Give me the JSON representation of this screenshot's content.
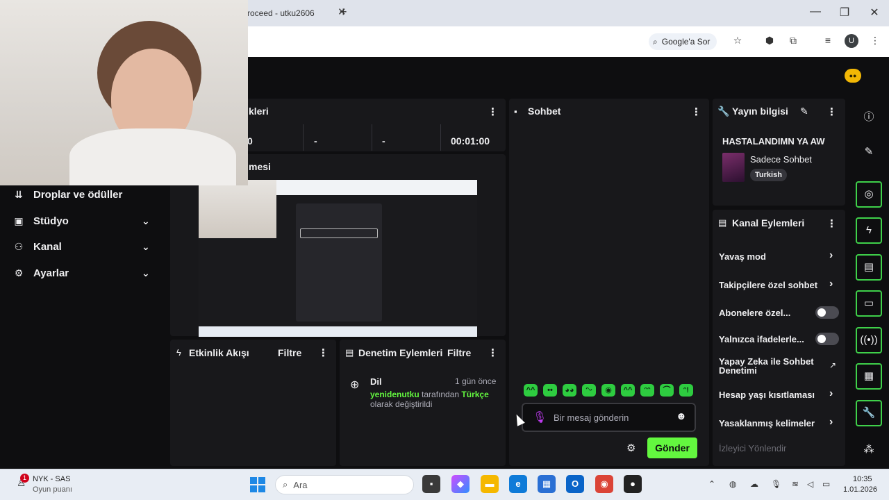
{
  "browser": {
    "tab_title": "roceed - utku2606",
    "tab_close": "✕",
    "new_tab": "+",
    "google_chip": "Google'a Sor",
    "profile_initial": "U"
  },
  "nav": {
    "items": [
      {
        "label": "Droplar ve ödüller",
        "icon": "drops-icon",
        "has_chevron": false
      },
      {
        "label": "Stüdyo",
        "icon": "studio-icon",
        "has_chevron": true
      },
      {
        "label": "Kanal",
        "icon": "channel-icon",
        "has_chevron": true
      },
      {
        "label": "Ayarlar",
        "icon": "settings-icon",
        "has_chevron": true
      }
    ]
  },
  "stats": {
    "title_fragment": "kleri",
    "values": [
      "0",
      "-",
      "-",
      "00:01:00"
    ]
  },
  "preview": {
    "title_fragment": "mesi"
  },
  "activity": {
    "title": "Etkinlik Akışı",
    "filter": "Filtre"
  },
  "moderation": {
    "title": "Denetim Eylemleri",
    "filter": "Filtre",
    "entry": {
      "type": "Dil",
      "time": "1 gün önce",
      "user": "yenidenutku",
      "mid": "tarafından",
      "value": "Türkçe",
      "tail": "olarak değiştirildi"
    }
  },
  "chat": {
    "title": "Sohbet",
    "placeholder": "Bir mesaj gönderin",
    "send_label": "Gönder",
    "emotes": [
      "^^",
      "••",
      "◕◕",
      "ᵔᵕ",
      "◉",
      "^^",
      "ᵔᵔ",
      "⌒",
      "ᵔ!"
    ]
  },
  "stream_info": {
    "title": "Yayın bilgisi",
    "stream_title": "HASTALANDIMN YA AW",
    "category": "Sadece Sohbet",
    "language_tag": "Turkish"
  },
  "channel_actions": {
    "title": "Kanal Eylemleri",
    "rows": [
      {
        "label": "Yavaş mod",
        "control": "chevron"
      },
      {
        "label": "Takipçilere özel sohbet",
        "control": "chevron"
      },
      {
        "label": "Abonelere özel...",
        "control": "toggle",
        "on": false
      },
      {
        "label": "Yalnızca ifadelerle...",
        "control": "toggle",
        "on": false
      },
      {
        "label": "Yapay Zeka ile Sohbet Denetimi",
        "control": "external"
      },
      {
        "label": "Hesap yaşı kısıtlaması",
        "control": "chevron"
      },
      {
        "label": "Yasaklanmış kelimeler",
        "control": "chevron"
      },
      {
        "label": "İzleyici Yönlendir",
        "control": "disabled"
      }
    ]
  },
  "taskbar": {
    "notif_count": "1",
    "game_title": "NYK - SAS",
    "game_sub": "Oyun puanı",
    "search_placeholder": "Ara",
    "time": "10:35",
    "date": "1.01.2026"
  },
  "colors": {
    "accent_green": "#63f73f",
    "rail_border": "#3fd14a",
    "panel_bg": "#18181b",
    "page_bg": "#0e0e10"
  }
}
